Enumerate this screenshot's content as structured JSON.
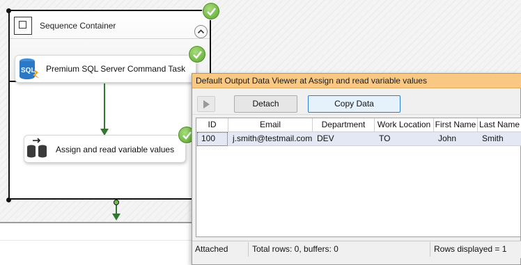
{
  "canvas": {
    "sequence_container": {
      "title": "Sequence Container",
      "collapse_glyph": "⌃",
      "icon": "sequence-container-icon"
    },
    "tasks": [
      {
        "label": "Premium SQL Server Command Task",
        "icon": "sql-icon",
        "icon_text": "SQL",
        "status": "success"
      },
      {
        "label": "Assign and read variable values",
        "icon": "database-icon",
        "status": "success"
      }
    ],
    "colors": {
      "success_green": "#5aa72e",
      "connector_green": "#2d7a2d",
      "viewer_title_bg": "#f9c983",
      "selected_row_bg": "#e3e8f4"
    }
  },
  "data_viewer": {
    "title": "Default Output Data Viewer at Assign and read variable values",
    "toolbar": {
      "play_icon": "play-icon",
      "detach_label": "Detach",
      "copy_label": "Copy Data"
    },
    "columns": [
      "ID",
      "Email",
      "Department",
      "Work Location",
      "First Name",
      "Last Name"
    ],
    "rows": [
      {
        "ID": "100",
        "Email": "j.smith@testmail.com",
        "Department": "DEV",
        "Work Location": "TO",
        "First Name": "John",
        "Last Name": "Smith"
      }
    ],
    "status": {
      "state": "Attached",
      "totals": "Total rows: 0, buffers: 0",
      "rows_displayed": "Rows displayed = 1"
    }
  }
}
